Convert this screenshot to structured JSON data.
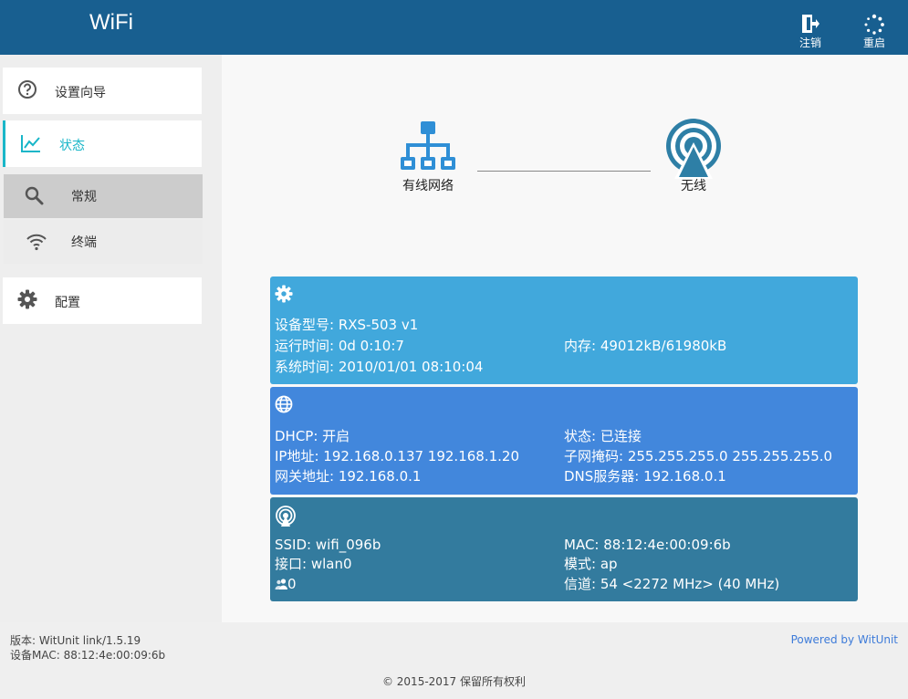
{
  "header": {
    "brand": "WiFi",
    "logout_label": "注销",
    "reboot_label": "重启"
  },
  "sidebar": {
    "wizard_label": "设置向导",
    "status_label": "状态",
    "general_label": "常规",
    "clients_label": "终端",
    "config_label": "配置"
  },
  "topology": {
    "wired_label": "有线网络",
    "wireless_label": "无线"
  },
  "system": {
    "model": "设备型号: RXS-503 v1",
    "uptime": "运行时间: 0d 0:10:7",
    "memory": "内存: 49012kB/61980kB",
    "systime": "系统时间: 2010/01/01 08:10:04"
  },
  "network": {
    "dhcp": "DHCP: 开启",
    "state": "状态: 已连接",
    "ip": "IP地址: 192.168.0.137 192.168.1.20",
    "netmask": "子网掩码: 255.255.255.0 255.255.255.0",
    "gateway": "网关地址: 192.168.0.1",
    "dns": "DNS服务器: 192.168.0.1"
  },
  "wireless": {
    "ssid": "SSID: wifi_096b",
    "mac": "MAC: 88:12:4e:00:09:6b",
    "iface": "接口: wlan0",
    "mode": "模式: ap",
    "clients_count": "0",
    "channel": "信道: 54 <2272 MHz> (40 MHz)"
  },
  "footer": {
    "version": "版本: WitUnit link/1.5.19",
    "device_mac": "设备MAC: 88:12:4e:00:09:6b",
    "powered": "Powered by WitUnit",
    "copyright": "© 2015-2017  保留所有权利"
  },
  "colors": {
    "header": "#185f90",
    "accent": "#19b6c8",
    "panel_system": "#41a8dc",
    "panel_network": "#4287dc",
    "panel_wireless": "#337b9e",
    "topology_icon": "#2f8fd6"
  }
}
